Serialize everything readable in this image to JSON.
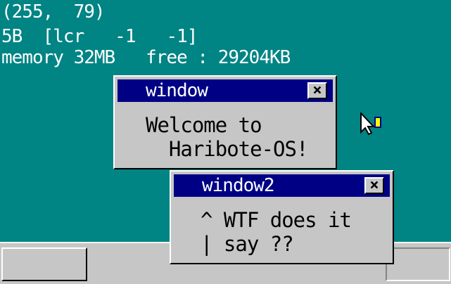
{
  "debug": {
    "mouse_coords": "(255,  79)",
    "mouse_state": "5B  [lcr   -1   -1]",
    "memory_line": "memory 32MB   free : 29204KB"
  },
  "windows": [
    {
      "title": "window",
      "close_label": "×",
      "lines": [
        "Welcome to",
        "  Haribote-OS!"
      ]
    },
    {
      "title": "window2",
      "close_label": "×",
      "lines": [
        "^ WTF does it",
        "| say ??"
      ]
    }
  ],
  "colors": {
    "desktop": "#008484",
    "titlebar": "#000084",
    "window_body": "#c6c6c6"
  },
  "icons": {
    "cursor": "mouse-pointer-icon",
    "close": "close-icon"
  }
}
